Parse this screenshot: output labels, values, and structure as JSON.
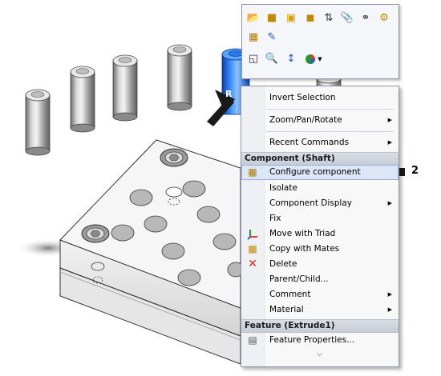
{
  "toolbar": {
    "icons": [
      "open-part-icon",
      "component-icon",
      "assembly-icon",
      "cube-search-icon",
      "sort-icon",
      "paperclip-icon",
      "mate-icon",
      "properties-icon",
      "configure-icon",
      "edit-sketch-icon",
      "selection-filter-icon",
      "zoom-icon",
      "axis-normal-icon",
      "appearance-icon"
    ]
  },
  "callouts": {
    "right_click": "R",
    "step": "2"
  },
  "menu": {
    "items_top": [
      {
        "label": "Invert Selection",
        "submenu": false
      },
      {
        "label": "Zoom/Pan/Rotate",
        "submenu": true
      },
      {
        "label": "Recent Commands",
        "submenu": true
      }
    ],
    "component_header": "Component (Shaft)",
    "component_items": [
      {
        "label": "Configure component",
        "icon": "configure-icon",
        "submenu": false
      },
      {
        "label": "Isolate",
        "icon": "",
        "submenu": false
      },
      {
        "label": "Component Display",
        "icon": "",
        "submenu": true
      },
      {
        "label": "Fix",
        "icon": "",
        "submenu": false
      },
      {
        "label": "Move with Triad",
        "icon": "triad-icon",
        "submenu": false
      },
      {
        "label": "Copy with Mates",
        "icon": "copy-mates-icon",
        "submenu": false
      },
      {
        "label": "Delete",
        "icon": "delete-icon",
        "submenu": false
      },
      {
        "label": "Parent/Child...",
        "icon": "",
        "submenu": false
      },
      {
        "label": "Comment",
        "icon": "",
        "submenu": true
      },
      {
        "label": "Material",
        "icon": "",
        "submenu": true
      }
    ],
    "feature_header": "Feature (Extrude1)",
    "feature_items": [
      {
        "label": "Feature Properties...",
        "icon": "properties-icon",
        "submenu": false
      }
    ],
    "expand_glyph": "⌵"
  },
  "colors": {
    "highlight": "#dde6f6",
    "header": "#c6ccd6",
    "shaft_selected": "#1e6fe0"
  }
}
